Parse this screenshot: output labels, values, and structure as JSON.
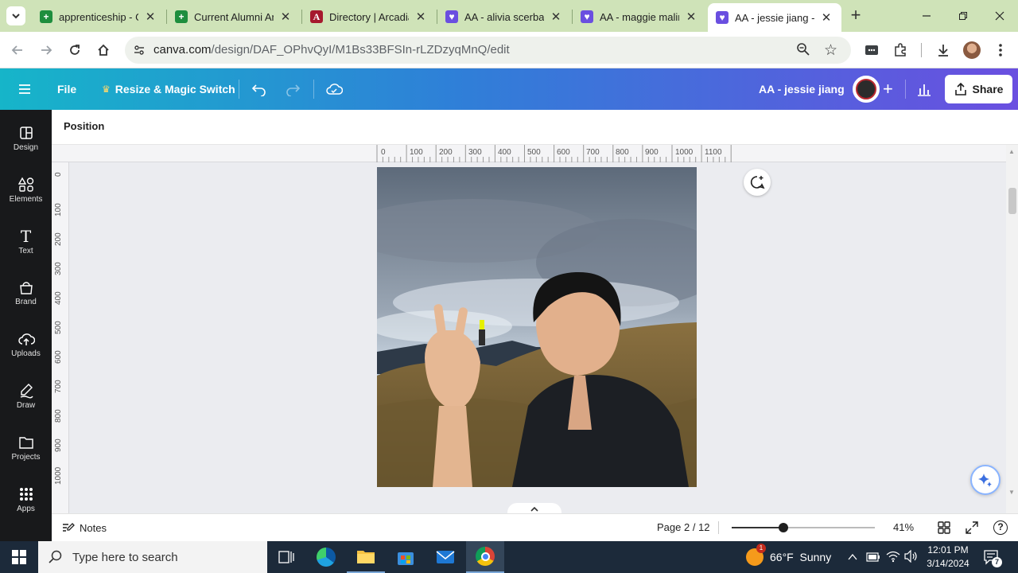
{
  "browser": {
    "tabs": [
      {
        "title": "apprenticeship - Go",
        "favicon": "sheets-icon",
        "color": "#1e8e3e"
      },
      {
        "title": "Current Alumni Am",
        "favicon": "sheets-icon",
        "color": "#1e8e3e"
      },
      {
        "title": "Directory | Arcadia",
        "favicon": "arcadia-icon",
        "color": "#a6192e"
      },
      {
        "title": "AA - alivia scerba",
        "favicon": "canva-heart-icon",
        "color": "#6a4fe0"
      },
      {
        "title": "AA - maggie malin",
        "favicon": "canva-heart-icon",
        "color": "#6a4fe0"
      },
      {
        "title": "AA - jessie jiang - I",
        "favicon": "canva-heart-icon",
        "color": "#6a4fe0",
        "active": true
      }
    ],
    "url_domain": "canva.com",
    "url_path": "/design/DAF_OPhvQyI/M1Bs33BFSIn-rLZDzyqMnQ/edit"
  },
  "canva_header": {
    "file_label": "File",
    "resize_label": "Resize & Magic Switch",
    "design_title": "AA - jessie jiang",
    "share_label": "Share"
  },
  "sidebar": {
    "items": [
      {
        "label": "Design",
        "icon": "design-icon"
      },
      {
        "label": "Elements",
        "icon": "elements-icon"
      },
      {
        "label": "Text",
        "icon": "text-icon"
      },
      {
        "label": "Brand",
        "icon": "brand-icon"
      },
      {
        "label": "Uploads",
        "icon": "uploads-icon"
      },
      {
        "label": "Draw",
        "icon": "draw-icon"
      },
      {
        "label": "Projects",
        "icon": "projects-icon"
      },
      {
        "label": "Apps",
        "icon": "apps-icon"
      }
    ]
  },
  "context_bar": {
    "position_label": "Position"
  },
  "rulers": {
    "horizontal": [
      "0",
      "100",
      "200",
      "300",
      "400",
      "500",
      "600",
      "700",
      "800",
      "900",
      "1000",
      "1100"
    ],
    "vertical": [
      "0",
      "100",
      "200",
      "300",
      "400",
      "500",
      "600",
      "700",
      "800",
      "900",
      "1000"
    ]
  },
  "footer": {
    "notes_label": "Notes",
    "page_indicator": "Page 2 / 12",
    "zoom_label": "41%",
    "zoom_value": 0.41
  },
  "taskbar": {
    "search_placeholder": "Type here to search",
    "weather": "66°F  Sunny",
    "weather_badge": "1",
    "time": "12:01 PM",
    "date": "3/14/2024",
    "notification_count": "7"
  }
}
